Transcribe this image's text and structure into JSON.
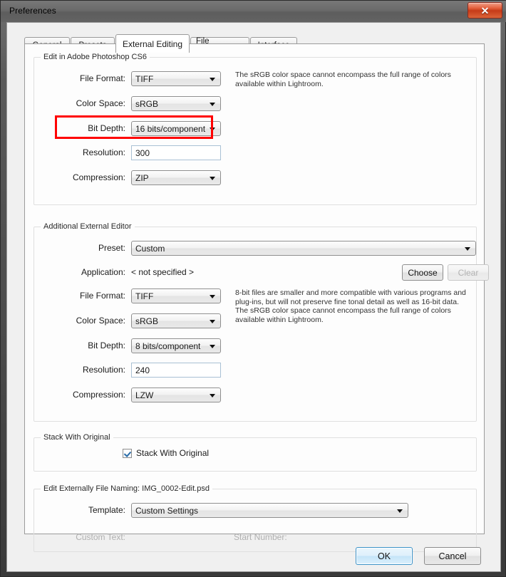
{
  "window": {
    "title": "Preferences",
    "close_label": "✕"
  },
  "tabs": [
    {
      "label": "General",
      "active": false
    },
    {
      "label": "Presets",
      "active": false
    },
    {
      "label": "External Editing",
      "active": true
    },
    {
      "label": "File Handling",
      "active": false
    },
    {
      "label": "Interface",
      "active": false
    }
  ],
  "edit_in_photoshop": {
    "legend": "Edit in Adobe Photoshop CS6",
    "file_format_label": "File Format:",
    "file_format_value": "TIFF",
    "color_space_label": "Color Space:",
    "color_space_value": "sRGB",
    "bit_depth_label": "Bit Depth:",
    "bit_depth_value": "16 bits/component",
    "resolution_label": "Resolution:",
    "resolution_value": "300",
    "compression_label": "Compression:",
    "compression_value": "ZIP",
    "help_text": "The sRGB color space cannot encompass the full range of colors\navailable within Lightroom."
  },
  "additional_editor": {
    "legend": "Additional External Editor",
    "preset_label": "Preset:",
    "preset_value": "Custom",
    "application_label": "Application:",
    "application_value": "< not specified >",
    "choose_label": "Choose",
    "clear_label": "Clear",
    "file_format_label": "File Format:",
    "file_format_value": "TIFF",
    "color_space_label": "Color Space:",
    "color_space_value": "sRGB",
    "bit_depth_label": "Bit Depth:",
    "bit_depth_value": "8 bits/component",
    "resolution_label": "Resolution:",
    "resolution_value": "240",
    "compression_label": "Compression:",
    "compression_value": "LZW",
    "help_text": "8-bit files are smaller and more compatible with various programs and\nplug-ins, but will not preserve fine tonal detail as well as 16-bit data.\nThe sRGB color space cannot encompass the full range of colors\navailable within Lightroom."
  },
  "stack_with_original": {
    "legend": "Stack With Original",
    "checkbox_label": "Stack With Original",
    "checked": true
  },
  "file_naming": {
    "legend": "Edit Externally File Naming:  IMG_0002-Edit.psd",
    "template_label": "Template:",
    "template_value": "Custom Settings",
    "custom_text_label": "Custom Text:",
    "start_number_label": "Start Number:"
  },
  "footer": {
    "ok_label": "OK",
    "cancel_label": "Cancel"
  },
  "annotation": {
    "color": "#ff0000",
    "target": "Color Space"
  }
}
